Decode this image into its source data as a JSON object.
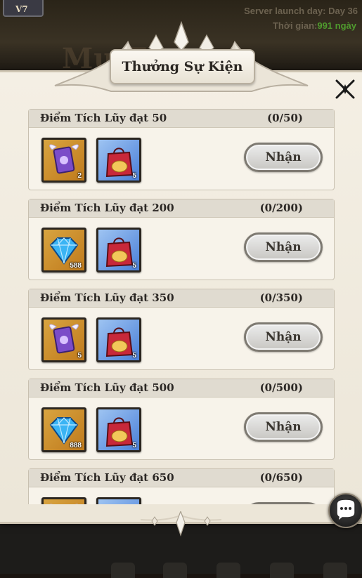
{
  "background": {
    "vip_label": "V7",
    "ghost_title": "Mu    T              ver",
    "server_launch": "Server launch day: Day 36",
    "time_label": "Thời gian:",
    "time_value": "991 ngày"
  },
  "panel": {
    "title": "Thưởng Sự Kiện",
    "close_icon": "close-icon"
  },
  "rewards": [
    {
      "title": "Điểm Tích Lũy đạt 50",
      "progress": "(0/50)",
      "items": [
        {
          "icon": "winged-card-icon",
          "count": "2",
          "bg": "gold"
        },
        {
          "icon": "gift-bag-icon",
          "count": "5",
          "bg": "blue"
        }
      ],
      "claim_label": "Nhận"
    },
    {
      "title": "Điểm Tích Lũy đạt 200",
      "progress": "(0/200)",
      "items": [
        {
          "icon": "diamond-icon",
          "count": "588",
          "bg": "gold"
        },
        {
          "icon": "gift-bag-icon",
          "count": "5",
          "bg": "blue"
        }
      ],
      "claim_label": "Nhận"
    },
    {
      "title": "Điểm Tích Lũy đạt 350",
      "progress": "(0/350)",
      "items": [
        {
          "icon": "winged-card-icon",
          "count": "5",
          "bg": "gold"
        },
        {
          "icon": "gift-bag-icon",
          "count": "5",
          "bg": "blue"
        }
      ],
      "claim_label": "Nhận"
    },
    {
      "title": "Điểm Tích Lũy đạt 500",
      "progress": "(0/500)",
      "items": [
        {
          "icon": "diamond-icon",
          "count": "888",
          "bg": "gold"
        },
        {
          "icon": "gift-bag-icon",
          "count": "5",
          "bg": "blue"
        }
      ],
      "claim_label": "Nhận"
    },
    {
      "title": "Điểm Tích Lũy đạt 650",
      "progress": "(0/650)",
      "items": [
        {
          "icon": "winged-card-icon",
          "count": "",
          "bg": "gold"
        },
        {
          "icon": "gift-bag-icon",
          "count": "",
          "bg": "blue"
        }
      ],
      "claim_label": ""
    }
  ],
  "chat_icon": "chat-bubble-icon",
  "colors": {
    "panel_bg": "#f4efe4",
    "accent_green": "#4f9a2e",
    "item_gold": "#d8a440",
    "item_blue": "#4a7fd8"
  }
}
